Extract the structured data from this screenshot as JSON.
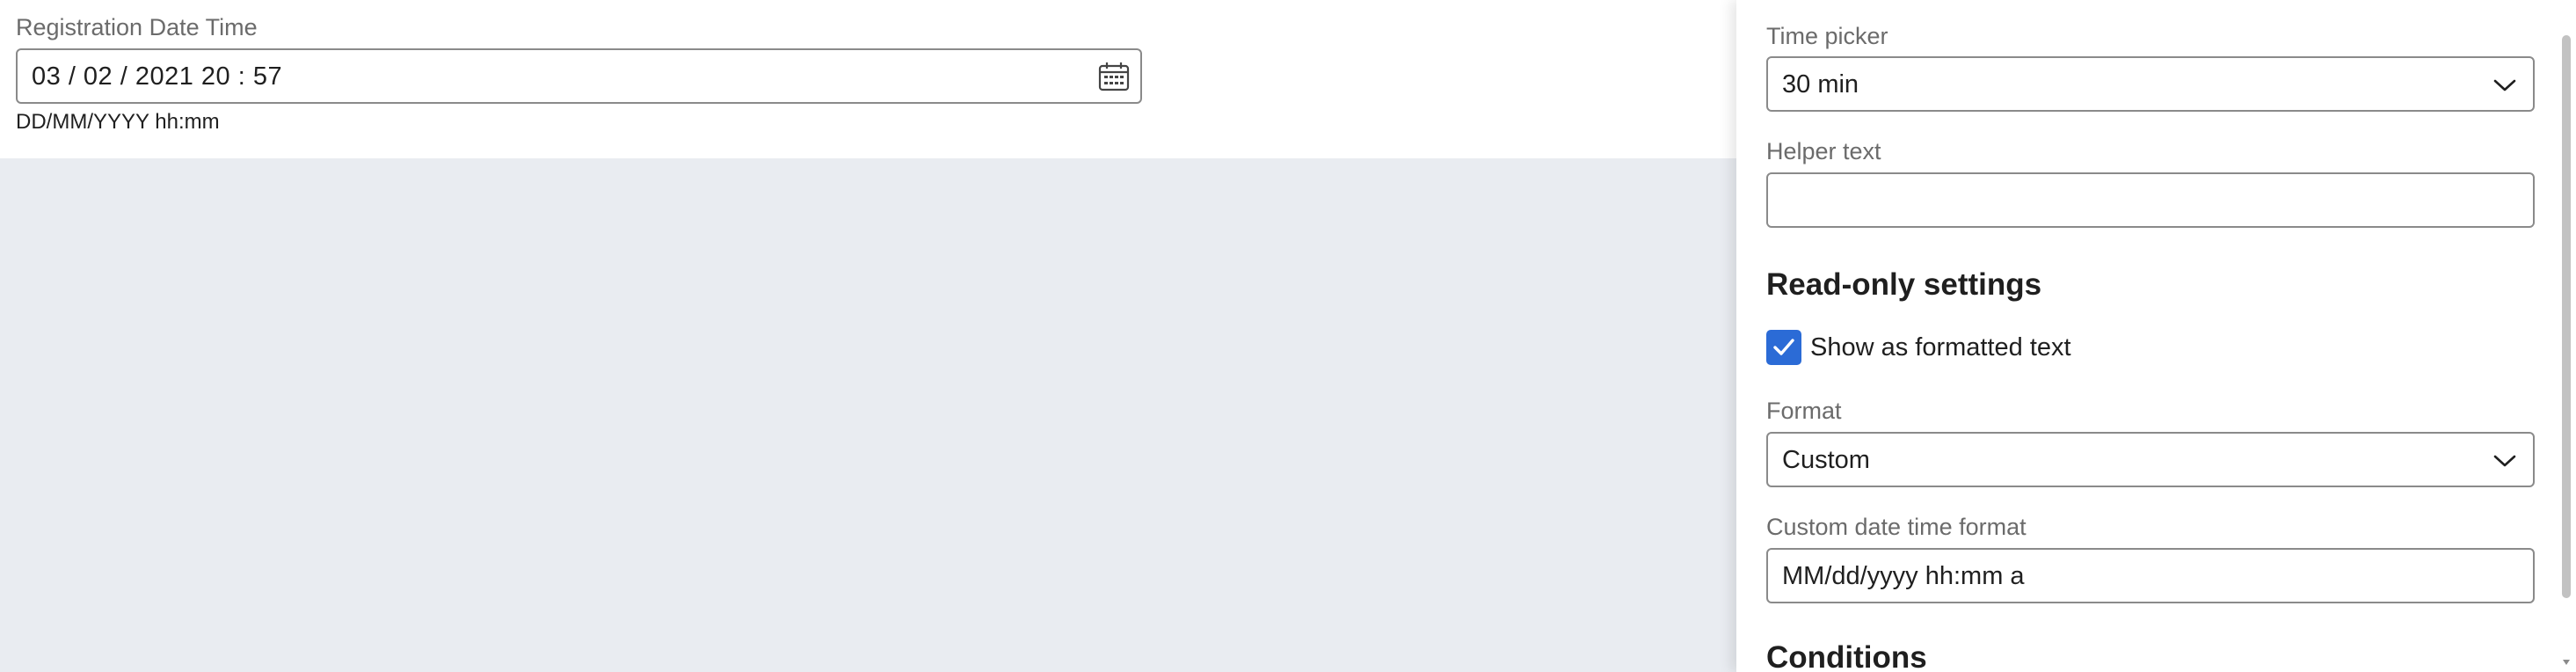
{
  "preview": {
    "field_label": "Registration Date Time",
    "field_value": "03 / 02 / 2021  20 : 57",
    "field_helper": "DD/MM/YYYY hh:mm",
    "calendar_icon": "calendar-icon"
  },
  "panel": {
    "time_picker": {
      "label": "Time picker",
      "value": "30 min"
    },
    "helper_text": {
      "label": "Helper text",
      "value": ""
    },
    "readonly_heading": "Read-only settings",
    "show_formatted": {
      "label": "Show as formatted text",
      "checked": true
    },
    "format": {
      "label": "Format",
      "value": "Custom"
    },
    "custom_format": {
      "label": "Custom date time format",
      "value": "MM/dd/yyyy hh:mm a"
    },
    "conditions_heading": "Conditions"
  },
  "colors": {
    "accent": "#2b6bd6",
    "canvas": "#e9ecf1",
    "border": "#8a8a8a",
    "label": "#6b6b6b"
  }
}
